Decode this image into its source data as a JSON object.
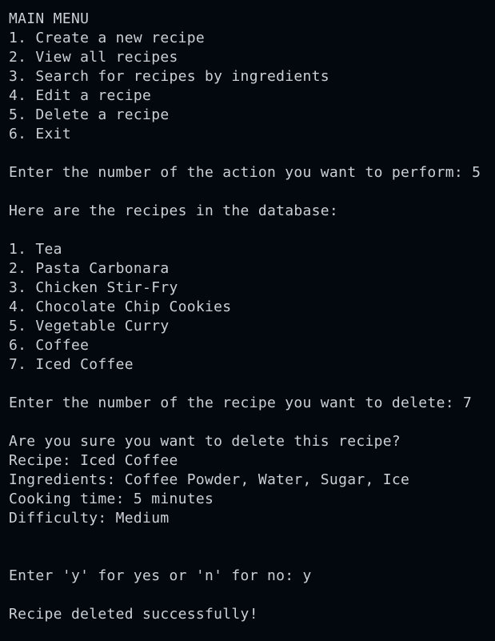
{
  "terminal": {
    "lines": [
      "MAIN MENU",
      "1. Create a new recipe",
      "2. View all recipes",
      "3. Search for recipes by ingredients",
      "4. Edit a recipe",
      "5. Delete a recipe",
      "6. Exit",
      "",
      "Enter the number of the action you want to perform: 5",
      "",
      "Here are the recipes in the database:",
      "",
      "1. Tea",
      "2. Pasta Carbonara",
      "3. Chicken Stir-Fry",
      "4. Chocolate Chip Cookies",
      "5. Vegetable Curry",
      "6. Coffee",
      "7. Iced Coffee",
      "",
      "Enter the number of the recipe you want to delete: 7",
      "",
      "Are you sure you want to delete this recipe?",
      "Recipe: Iced Coffee",
      "Ingredients: Coffee Powder, Water, Sugar, Ice",
      "Cooking time: 5 minutes",
      "Difficulty: Medium",
      "",
      "",
      "Enter 'y' for yes or 'n' for no: y",
      "",
      "Recipe deleted successfully!"
    ]
  }
}
